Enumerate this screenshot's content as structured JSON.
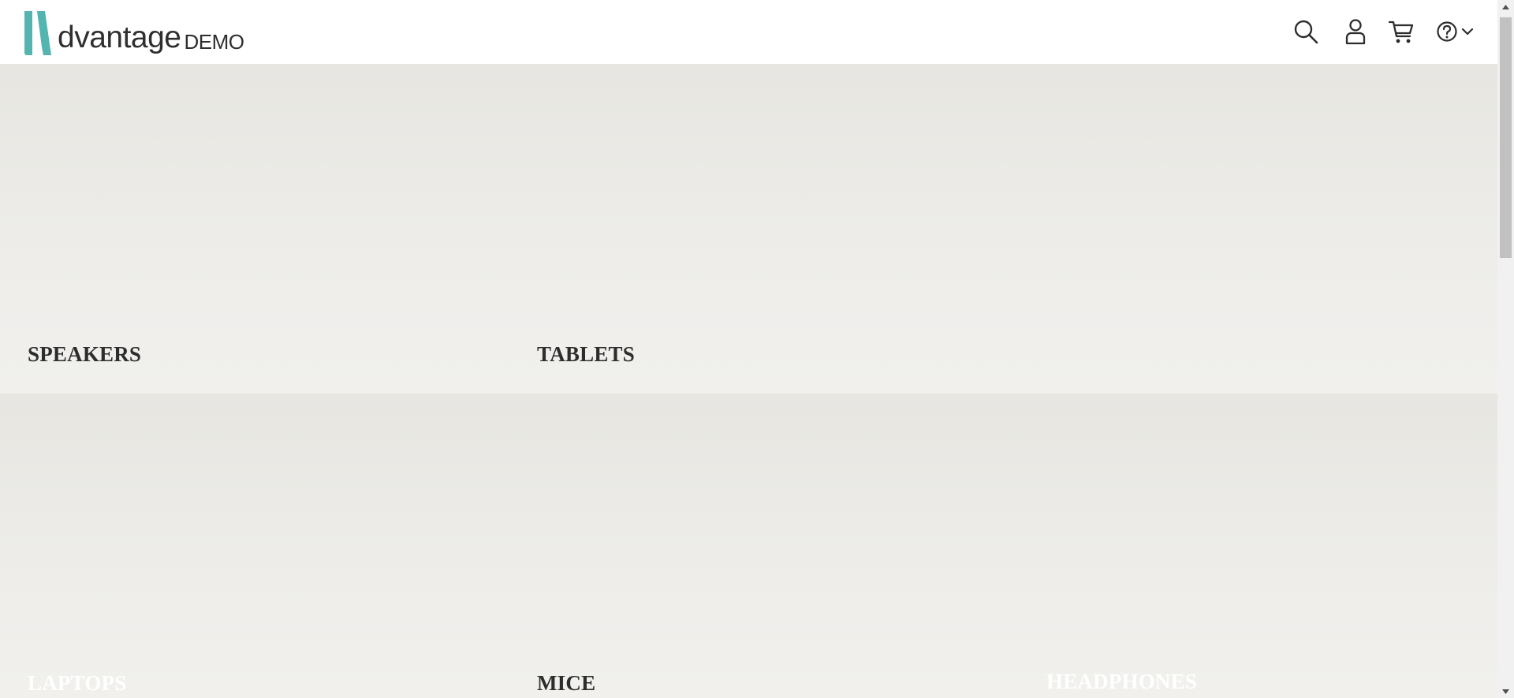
{
  "header": {
    "logo": {
      "letter_mark": "A",
      "word": "dvantage",
      "suffix": "DEMO",
      "accent_color": "#54b5b0"
    },
    "icons": [
      {
        "name": "search-icon"
      },
      {
        "name": "user-icon"
      },
      {
        "name": "cart-icon"
      },
      {
        "name": "help-icon"
      },
      {
        "name": "chevron-down-icon"
      }
    ]
  },
  "categories": [
    {
      "label": "SPEAKERS",
      "label_color": "#2d2d2d"
    },
    {
      "label": "TABLETS",
      "label_color": "#2d2d2d"
    },
    {
      "label": "LAPTOPS",
      "label_color": "#ffffff"
    },
    {
      "label": "MICE",
      "label_color": "#2d2d2d"
    },
    {
      "label": "HEADPHONES",
      "label_color": "#ffffff"
    }
  ],
  "colors": {
    "tile_background": "#ebeae6",
    "text_dark": "#2d2d2d",
    "text_light": "#ffffff",
    "scrollbar_thumb": "#c1c1c1"
  }
}
